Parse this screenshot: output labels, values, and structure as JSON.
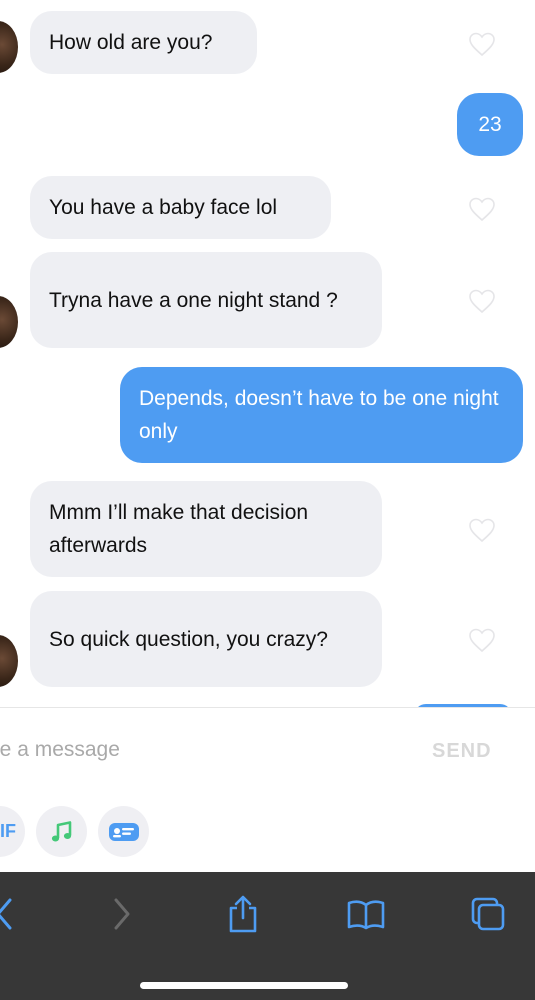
{
  "messages": [
    {
      "side": "in",
      "text": "How old are you?",
      "avatar": true
    },
    {
      "side": "out",
      "text": "23"
    },
    {
      "side": "in",
      "text": "You have a baby face lol"
    },
    {
      "side": "in",
      "text": "Tryna have a one night stand ?",
      "avatar": true
    },
    {
      "side": "out",
      "text": "Depends, doesn’t have to be one night only"
    },
    {
      "side": "in",
      "text": "Mmm I’ll make that decision afterwards"
    },
    {
      "side": "in",
      "text": "So quick question, you crazy?",
      "avatar": true
    }
  ],
  "composer": {
    "placeholder": "pe a message",
    "send_label": "SEND"
  },
  "extras": {
    "gif_label": "IF"
  },
  "colors": {
    "outgoing": "#4e9cf2",
    "incoming": "#eeeff3",
    "music_icon": "#44c878",
    "browser_bar": "#373737",
    "browser_icons": "#4e9cf2"
  },
  "icons": [
    "heart-icon",
    "music-note-icon",
    "id-card-icon",
    "back-icon",
    "forward-icon",
    "share-icon",
    "bookmarks-icon",
    "tabs-icon"
  ]
}
